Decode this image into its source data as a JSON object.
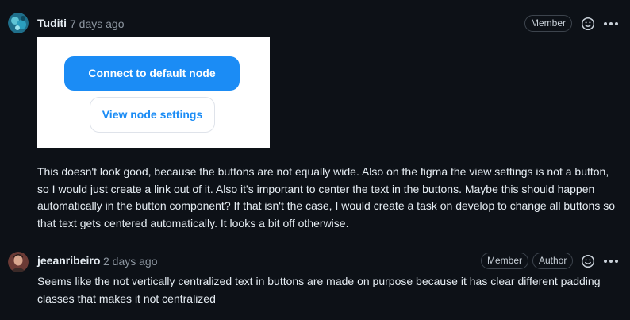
{
  "comments": [
    {
      "author": "Tuditi",
      "time": "7 days ago",
      "badges": [
        "Member"
      ],
      "embed": {
        "primary_button": "Connect to default node",
        "secondary_button": "View node settings"
      },
      "body": "This doesn't look good, because the buttons are not equally wide. Also on the figma the view settings is not a button, so I would just create a link out of it. Also it's important to center the text in the buttons. Maybe this should happen automatically in the button component? If that isn't the case, I would create a task on develop to change all buttons so that text gets centered automatically. It looks a bit off otherwise."
    },
    {
      "author": "jeeanribeiro",
      "time": "2 days ago",
      "badges": [
        "Member",
        "Author"
      ],
      "body": "Seems like the not vertically centralized text in buttons are made on purpose because it has clear different padding classes that makes it not centralized"
    }
  ],
  "icons": {
    "reaction": "smiley-icon",
    "menu": "kebab-horizontal-icon"
  }
}
